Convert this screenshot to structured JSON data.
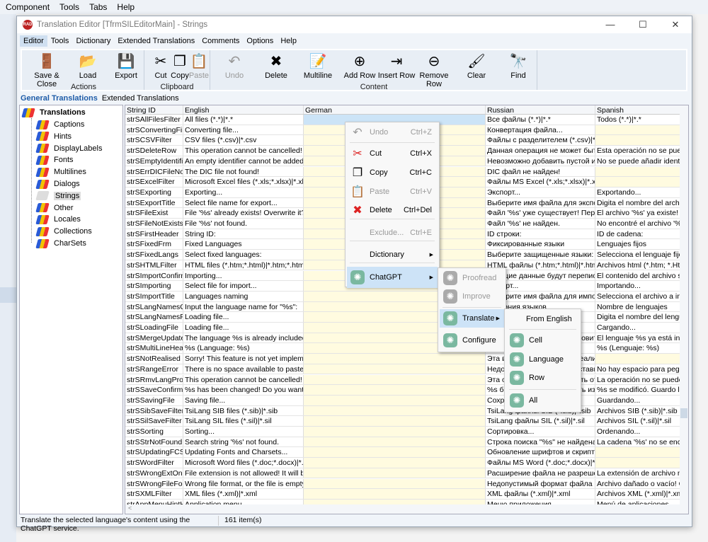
{
  "ide": {
    "menu": [
      "Component",
      "Tools",
      "Tabs",
      "Help"
    ]
  },
  "window": {
    "title": "Translation Editor [TfrmSILEditorMain] - Strings",
    "controls": [
      "—",
      "☐",
      "✕"
    ]
  },
  "menubar": [
    "Editor",
    "Tools",
    "Dictionary",
    "Extended Translations",
    "Comments",
    "Options",
    "Help"
  ],
  "ribbon": {
    "buttons": [
      {
        "label": "Save & Close",
        "icon": "save-close-icon",
        "glyph": "🚪"
      },
      {
        "label": "Load",
        "icon": "folder-icon",
        "glyph": "📂"
      },
      {
        "label": "Export",
        "icon": "floppy-icon",
        "glyph": "💾"
      },
      {
        "label": "Cut",
        "icon": "scissors-icon",
        "glyph": "✂"
      },
      {
        "label": "Copy",
        "icon": "copy-icon",
        "glyph": "❐"
      },
      {
        "label": "Paste",
        "icon": "clipboard-icon",
        "glyph": "📋"
      },
      {
        "label": "Undo",
        "icon": "undo-icon",
        "glyph": "↶"
      },
      {
        "label": "Delete",
        "icon": "delete-x-icon",
        "glyph": "✖"
      },
      {
        "label": "Multiline",
        "icon": "multiline-icon",
        "glyph": "📝"
      },
      {
        "label": "Add Row",
        "icon": "add-row-icon",
        "glyph": "⊕"
      },
      {
        "label": "Insert Row",
        "icon": "insert-row-icon",
        "glyph": "⇥"
      },
      {
        "label": "Remove Row",
        "icon": "remove-row-icon",
        "glyph": "⊖"
      },
      {
        "label": "Clear",
        "icon": "brush-icon",
        "glyph": "🖌"
      },
      {
        "label": "Find",
        "icon": "binoculars-icon",
        "glyph": "🔭"
      }
    ],
    "groups": [
      "Actions",
      "Clipboard",
      "Content"
    ]
  },
  "tabs": [
    "General Translations",
    "Extended Translations"
  ],
  "tree": {
    "root": "Translations",
    "items": [
      "Captions",
      "Hints",
      "DisplayLabels",
      "Fonts",
      "Multilines",
      "Dialogs",
      "Strings",
      "Other",
      "Locales",
      "Collections",
      "CharSets"
    ],
    "selected": "Strings"
  },
  "grid": {
    "columns": [
      "String ID",
      "English",
      "German",
      "Russian",
      "Spanish"
    ],
    "rows": [
      [
        "strSAllFilesFilter",
        "All files (*.*)|*.*",
        "",
        "Все файлы (*.*)|*.*",
        "Todos (*.*)|*.*"
      ],
      [
        "strSConvertingFile",
        "Converting file...",
        "",
        "Конвертация файла...",
        ""
      ],
      [
        "strSCSVFilter",
        "CSV files (*.csv)|*.csv",
        "",
        "Файлы с разделителем (*.csv)|*.csv",
        ""
      ],
      [
        "strSDeleteRow",
        "This operation cannot be cancelled! Remove the row?",
        "",
        "Данная операция не может быть отменена!",
        "Esta operación no se puede cancelar"
      ],
      [
        "strSEmptyIdentifier",
        "An empty identifier cannot be added.",
        "",
        "Невозможно добавить пустой идентификатор",
        "No se puede añadir identificador"
      ],
      [
        "strSErrDICFileNotExist",
        "The DIC file not found!",
        "",
        "DIC файл не найден!",
        ""
      ],
      [
        "strSExcelFilter",
        "Microsoft Excel files (*.xls;*.xlsx)|*.xls;*.xlsx",
        "",
        "Файлы MS Excel (*.xls;*.xlsx)|*.xls;*.xlsx",
        ""
      ],
      [
        "strSExporting",
        "Exporting...",
        "",
        "Экспорт...",
        "Exportando..."
      ],
      [
        "strSExportTitle",
        "Select file name for export...",
        "",
        "Выберите имя файла для экспорта...",
        "Digita el nombre del archivo para"
      ],
      [
        "strSFileExist",
        "File '%s' already exists! Overwrite it?",
        "",
        "Файл '%s' уже существует! Перезаписать?",
        "El archivo '%s' ya existe! Sobreescribir?"
      ],
      [
        "strSFileNotExists",
        "File '%s' not found.",
        "",
        "Файл '%s' не найден.",
        "No encontré el archivo '%s'"
      ],
      [
        "strSFirstHeader",
        "String ID:",
        "",
        "ID строки:",
        "ID de cadena:"
      ],
      [
        "strSFixedFrm",
        "Fixed Languages",
        "",
        "Фиксированные языки",
        "Lenguajes fijos"
      ],
      [
        "strSFixedLangs",
        "Select fixed languages:",
        "",
        "Выберите защищенные языки:",
        "Selecciona el lenguaje fijo:"
      ],
      [
        "strSHTMLFilter",
        "HTML files (*.htm;*.html)|*.htm;*.html",
        "",
        "HTML файлы (*.htm;*.html)|*.htm;*.html",
        "Archivos html (*.htm; *.Html)|*"
      ],
      [
        "strSImportConfirm",
        "Importing...",
        "",
        "Текущие данные будут переписаны! Пр",
        "El contenido del archivo se sobrescribirá"
      ],
      [
        "strSImporting",
        "Select file for import...",
        "",
        "Импорт...",
        "Importando..."
      ],
      [
        "strSImportTitle",
        "Languages naming",
        "",
        "Выберите имя файла для импорта...",
        "Selecciona el archivo a importar"
      ],
      [
        "strSLangNamesCapt",
        "Input the language name for \"%s\":",
        "",
        "Названия языков",
        "Nombre de lenguajes"
      ],
      [
        "strSLangNamesPrompt",
        "Loading file...",
        "",
        "",
        "Digita el nombre del lenguaje para"
      ],
      [
        "strSLoadingFile",
        "Loading file...",
        "",
        "",
        "Cargando..."
      ],
      [
        "strSMergeUpdate",
        "The language %s is already included! Would you",
        "",
        "Язык %s уже включен! Обновить текущий",
        "El lenguaje %s ya está incluído! ¿"
      ],
      [
        "strSMultiLineHeader",
        "%s (Language: %s)",
        "",
        "",
        "%s (Lenguaje: %s)"
      ],
      [
        "strSNotRealised",
        "Sorry! This feature is not yet implemented!",
        "",
        "Эта возможность еще не реализована!",
        ""
      ],
      [
        "strSRangeError",
        "There is no space available to paste the range",
        "",
        "Недостаточно места для вставки набора",
        "No hay espacio para pegar del portapapeles"
      ],
      [
        "strSRmvLangPrompt",
        "This operation cannot be cancelled! Remove the",
        "",
        "Эта операция не может быть отменена!",
        "La operación no se puede cancelar"
      ],
      [
        "strSSaveConfirm",
        "%s has been changed! Do you want to save the",
        "",
        "%s был изменен! Сохранить изм",
        "%s se modificó. Guardo los cambios?"
      ],
      [
        "strSSavingFile",
        "Saving file...",
        "",
        "Сохранение файла...",
        "Guardando..."
      ],
      [
        "strSSibSaveFilter",
        "TsiLang SIB files (*.sib)|*.sib",
        "",
        "TsiLang файлы SIB (*.sib)|*.sib",
        "Archivos SIB (*.sib)|*.sib"
      ],
      [
        "strSSilSaveFilter",
        "TsiLang SIL files (*.sil)|*.sil",
        "",
        "TsiLang файлы SIL (*.sil)|*.sil",
        "Archivos SIL  (*.sil)|*.sil"
      ],
      [
        "strSSorting",
        "Sorting...",
        "",
        "Сортировка...",
        "Ordenando..."
      ],
      [
        "strSStrNotFound",
        "Search string '%s' not found.",
        "",
        "Строка поиска \"%s\" не найдена.",
        "La cadena '%s' no se encontró."
      ],
      [
        "strSUpdatingFCS",
        "Updating Fonts and Charsets...",
        "",
        "Обновление шрифтов и скриптов...",
        ""
      ],
      [
        "strSWordFilter",
        "Microsoft Word files (*.doc;*.docx)|*.doc;*.docx",
        "",
        "Файлы MS Word (*.doc;*.docx)|*.doc;*.docx",
        ""
      ],
      [
        "strSWrongExtOnImp",
        "File extension is not allowed! It will be imported",
        "",
        "Расширение файла не разрешено! Он будет",
        "La extensión de archivo no está"
      ],
      [
        "strSWrongFileFormat",
        "Wrong file format, or the file is empty! Please",
        "",
        "Недопустимый формат файла или файл пуст!",
        "Archivo dañado o vacío! Checa"
      ],
      [
        "strSXMLFilter",
        "XML files (*.xml)|*.xml",
        "",
        "XML файлы (*.xml)|*.xml",
        "Archivos XML (*.xml)|*.xml"
      ],
      [
        "strAppMenuHintHeader",
        "Application menu",
        "",
        "Меню приложения",
        "Menú de aplicaciones"
      ]
    ]
  },
  "status": {
    "hint": "Translate the selected language's content using the ChatGPT service.",
    "count": "161 item(s)"
  },
  "context_menu": {
    "items": [
      {
        "label": "Undo",
        "shortcut": "Ctrl+Z",
        "icon": "undo-icon",
        "glyph": "↶",
        "disabled": true
      },
      {
        "label": "Cut",
        "shortcut": "Ctrl+X",
        "icon": "scissors-icon",
        "glyph": "✂"
      },
      {
        "label": "Copy",
        "shortcut": "Ctrl+C",
        "icon": "copy-icon",
        "glyph": "❐"
      },
      {
        "label": "Paste",
        "shortcut": "Ctrl+V",
        "icon": "clipboard-icon",
        "glyph": "📋",
        "disabled": true
      },
      {
        "label": "Delete",
        "shortcut": "Ctrl+Del",
        "icon": "delete-x-icon",
        "glyph": "✖"
      },
      {
        "label": "Exclude...",
        "shortcut": "Ctrl+E",
        "disabled": true
      },
      {
        "label": "Dictionary",
        "submenu": true
      },
      {
        "label": "ChatGPT",
        "submenu": true,
        "icon": "chatgpt-icon",
        "highlighted": true
      }
    ]
  },
  "chatgpt_menu": {
    "items": [
      {
        "label": "Proofread",
        "disabled": true
      },
      {
        "label": "Improve",
        "disabled": true
      },
      {
        "label": "Translate",
        "highlighted": true,
        "submenu": true
      },
      {
        "label": "Configure"
      }
    ]
  },
  "translate_menu": {
    "header": "From English",
    "items": [
      "Cell",
      "Language",
      "Row",
      "All"
    ]
  }
}
